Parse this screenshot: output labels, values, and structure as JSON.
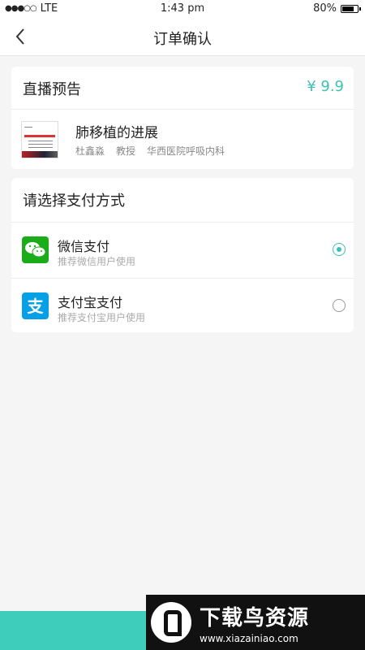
{
  "status_bar": {
    "signal_dots": "●●●○○",
    "carrier": "LTE",
    "time": "1:43 pm",
    "battery_text": "80%",
    "battery_level": 0.8
  },
  "nav": {
    "title": "订单确认",
    "back_icon": "chevron-left-icon"
  },
  "order": {
    "header_label": "直播预告",
    "price": "¥ 9.9",
    "course": {
      "title": "肺移植的进展",
      "lecturer": "杜鑫淼",
      "position": "教授",
      "hospital": "华西医院呼吸内科"
    }
  },
  "payment": {
    "header_label": "请选择支付方式",
    "methods": [
      {
        "name": "微信支付",
        "subtitle": "推荐微信用户使用",
        "icon": "wechat-icon",
        "selected": true
      },
      {
        "name": "支付宝支付",
        "subtitle": "推荐支付宝用户使用",
        "icon": "alipay-icon",
        "selected": false
      }
    ]
  },
  "watermark": {
    "title": "下载鸟资源",
    "url": "www.xiazainiao.com"
  },
  "colors": {
    "accent": "#3cc1b4",
    "wechat": "#1aad19",
    "alipay": "#06a0e6",
    "bottom_bar": "#3ecdbb"
  }
}
